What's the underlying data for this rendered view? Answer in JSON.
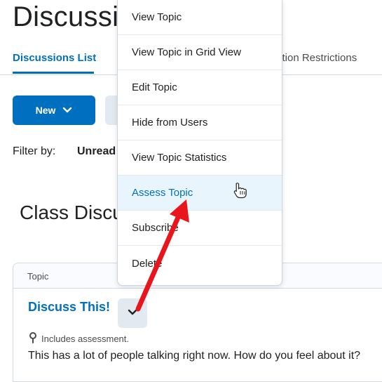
{
  "page": {
    "title": "Discussions"
  },
  "tabs": {
    "active": "Discussions List",
    "other": "ction Restrictions"
  },
  "toolbar": {
    "new_label": "New"
  },
  "filter": {
    "label": "Filter by:",
    "value": "Unread"
  },
  "section": {
    "title": "Class Discussions"
  },
  "table": {
    "header_topic": "Topic",
    "row": {
      "title": "Discuss This!",
      "assessment_note": "Includes assessment.",
      "description": "This has a lot of people talking right now. How do you feel about it?"
    }
  },
  "menu": {
    "items": [
      {
        "label": "View Topic"
      },
      {
        "label": "View Topic in Grid View"
      },
      {
        "label": "Edit Topic"
      },
      {
        "label": "Hide from Users"
      },
      {
        "label": "View Topic Statistics"
      },
      {
        "label": "Assess Topic"
      },
      {
        "label": "Subscribe"
      },
      {
        "label": "Delete"
      }
    ],
    "hovered_index": 5
  },
  "colors": {
    "accent": "#006fbf",
    "annotation": "#e8161c",
    "hover_bg": "#e9f5fc"
  },
  "icons": [
    "chevron-down-icon",
    "map-pin-icon",
    "hand-pointer-cursor-icon",
    "red-arrow-annotation"
  ]
}
